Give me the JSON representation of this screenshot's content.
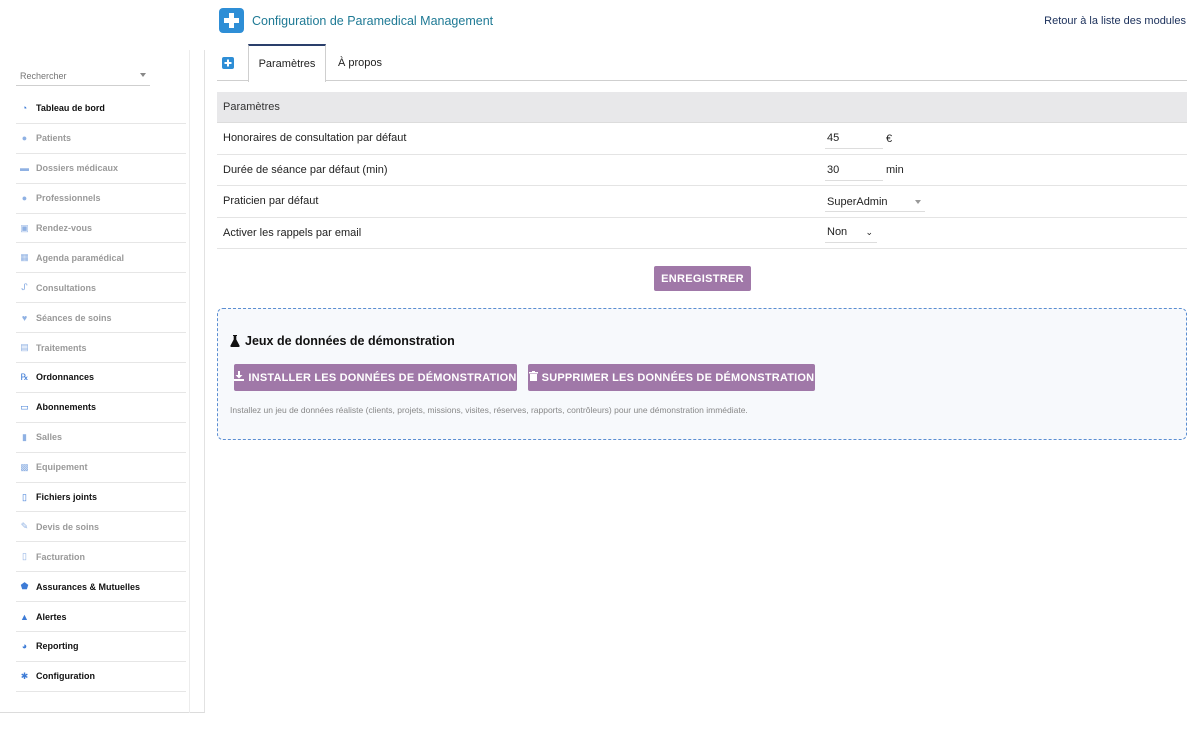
{
  "header": {
    "title": "Configuration de Paramedical Management",
    "back_link": "Retour à la liste des modules"
  },
  "sidebar": {
    "search_placeholder": "Rechercher",
    "items": [
      {
        "label": "Tableau de bord",
        "icon": "dashboard-icon",
        "style": "bold"
      },
      {
        "label": "Patients",
        "icon": "user-icon",
        "style": "dim"
      },
      {
        "label": "Dossiers médicaux",
        "icon": "folder-icon",
        "style": "dim"
      },
      {
        "label": "Professionnels",
        "icon": "user-icon",
        "style": "dim"
      },
      {
        "label": "Rendez-vous",
        "icon": "calendar-check-icon",
        "style": "dim"
      },
      {
        "label": "Agenda paramédical",
        "icon": "calendar-icon",
        "style": "dim"
      },
      {
        "label": "Consultations",
        "icon": "stethoscope-icon",
        "style": "dim"
      },
      {
        "label": "Séances de soins",
        "icon": "heartbeat-icon",
        "style": "dim"
      },
      {
        "label": "Traitements",
        "icon": "pill-box-icon",
        "style": "dim"
      },
      {
        "label": "Ordonnances",
        "icon": "prescription-icon",
        "style": "bold"
      },
      {
        "label": "Abonnements",
        "icon": "card-icon",
        "style": "bold"
      },
      {
        "label": "Salles",
        "icon": "door-icon",
        "style": "dim"
      },
      {
        "label": "Equipement",
        "icon": "toolbox-icon",
        "style": "dim"
      },
      {
        "label": "Fichiers joints",
        "icon": "file-icon",
        "style": "bold"
      },
      {
        "label": "Devis de soins",
        "icon": "edit-icon",
        "style": "dim"
      },
      {
        "label": "Facturation",
        "icon": "invoice-icon",
        "style": "dim"
      },
      {
        "label": "Assurances & Mutuelles",
        "icon": "shield-icon",
        "style": "bold"
      },
      {
        "label": "Alertes",
        "icon": "warning-icon",
        "style": "bold"
      },
      {
        "label": "Reporting",
        "icon": "pie-chart-icon",
        "style": "bold"
      },
      {
        "label": "Configuration",
        "icon": "gear-icon",
        "style": "bold"
      }
    ]
  },
  "tabs": [
    {
      "label": "Paramètres",
      "active": true
    },
    {
      "label": "À propos",
      "active": false
    }
  ],
  "settings": {
    "section_title": "Paramètres",
    "rows": [
      {
        "label": "Honoraires de consultation par défaut",
        "value": "45",
        "unit": "€"
      },
      {
        "label": "Durée de séance par défaut (min)",
        "value": "30",
        "unit": "min"
      },
      {
        "label": "Praticien par défaut",
        "value": "SuperAdmin"
      },
      {
        "label": "Activer les rappels par email",
        "value": "Non"
      }
    ],
    "save_label": "ENREGISTRER"
  },
  "demo": {
    "title": "Jeux de données de démonstration",
    "install_label": "INSTALLER LES DONNÉES DE DÉMONSTRATION",
    "delete_label": "SUPPRIMER LES DONNÉES DE DÉMONSTRATION",
    "hint": "Installez un jeu de données réaliste (clients, projets, missions, visites, réserves, rapports, contrôleurs) pour une démonstration immédiate."
  },
  "colors": {
    "accent_button": "#a078a8",
    "brand_blue": "#2e8ed6",
    "title_teal": "#1f7a95",
    "demo_border": "#5b8ed2"
  }
}
